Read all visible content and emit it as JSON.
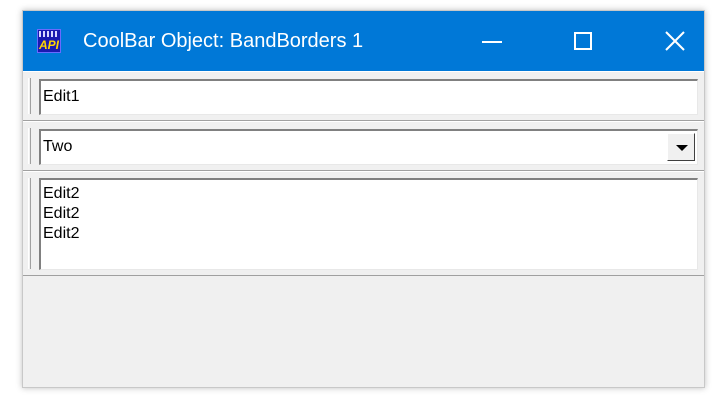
{
  "window": {
    "title": "CoolBar Object: BandBorders 1",
    "icon": "api-app-icon",
    "accent_color": "#0078d7"
  },
  "caption_buttons": {
    "minimize_icon": "minimize-icon",
    "maximize_icon": "maximize-icon",
    "close_icon": "close-icon"
  },
  "bands": {
    "band1": {
      "edit_value": "Edit1"
    },
    "band2": {
      "combo_value": "Two",
      "dropdown_icon": "chevron-down-icon"
    },
    "band3": {
      "memo_lines": [
        "Edit2",
        "Edit2",
        "Edit2"
      ]
    }
  }
}
